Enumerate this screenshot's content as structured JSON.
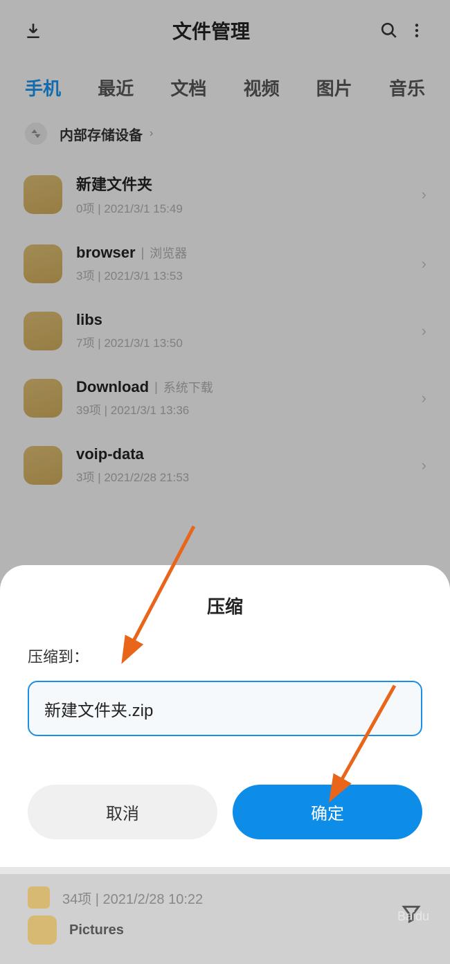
{
  "header": {
    "title": "文件管理"
  },
  "tabs": [
    "手机",
    "最近",
    "文档",
    "视频",
    "图片",
    "音乐"
  ],
  "activeTab": 0,
  "breadcrumb": {
    "label": "内部存储设备"
  },
  "files": [
    {
      "name": "新建文件夹",
      "tag": "",
      "count": "0项",
      "date": "2021/3/1 15:49"
    },
    {
      "name": "browser",
      "tag": "浏览器",
      "count": "3项",
      "date": "2021/3/1 13:53"
    },
    {
      "name": "libs",
      "tag": "",
      "count": "7项",
      "date": "2021/3/1 13:50"
    },
    {
      "name": "Download",
      "tag": "系统下载",
      "count": "39项",
      "date": "2021/3/1 13:36"
    },
    {
      "name": "voip-data",
      "tag": "",
      "count": "3项",
      "date": "2021/2/28 21:53"
    }
  ],
  "dialog": {
    "title": "压缩",
    "label": "压缩到：",
    "input_value": "新建文件夹.zip",
    "cancel": "取消",
    "confirm": "确定"
  },
  "bottom": {
    "folder_meta": "34项 | 2021/2/28 10:22",
    "folder_name": "Pictures"
  }
}
